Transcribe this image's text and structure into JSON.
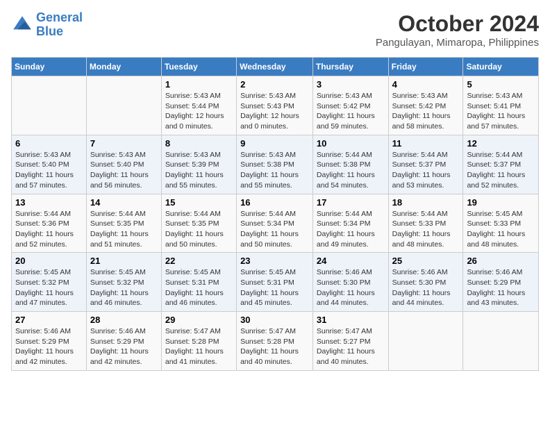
{
  "logo": {
    "line1": "General",
    "line2": "Blue"
  },
  "title": "October 2024",
  "subtitle": "Pangulayan, Mimaropa, Philippines",
  "days_of_week": [
    "Sunday",
    "Monday",
    "Tuesday",
    "Wednesday",
    "Thursday",
    "Friday",
    "Saturday"
  ],
  "weeks": [
    [
      {
        "day": "",
        "content": ""
      },
      {
        "day": "",
        "content": ""
      },
      {
        "day": "1",
        "content": "Sunrise: 5:43 AM\nSunset: 5:44 PM\nDaylight: 12 hours and 0 minutes."
      },
      {
        "day": "2",
        "content": "Sunrise: 5:43 AM\nSunset: 5:43 PM\nDaylight: 12 hours and 0 minutes."
      },
      {
        "day": "3",
        "content": "Sunrise: 5:43 AM\nSunset: 5:42 PM\nDaylight: 11 hours and 59 minutes."
      },
      {
        "day": "4",
        "content": "Sunrise: 5:43 AM\nSunset: 5:42 PM\nDaylight: 11 hours and 58 minutes."
      },
      {
        "day": "5",
        "content": "Sunrise: 5:43 AM\nSunset: 5:41 PM\nDaylight: 11 hours and 57 minutes."
      }
    ],
    [
      {
        "day": "6",
        "content": "Sunrise: 5:43 AM\nSunset: 5:40 PM\nDaylight: 11 hours and 57 minutes."
      },
      {
        "day": "7",
        "content": "Sunrise: 5:43 AM\nSunset: 5:40 PM\nDaylight: 11 hours and 56 minutes."
      },
      {
        "day": "8",
        "content": "Sunrise: 5:43 AM\nSunset: 5:39 PM\nDaylight: 11 hours and 55 minutes."
      },
      {
        "day": "9",
        "content": "Sunrise: 5:43 AM\nSunset: 5:38 PM\nDaylight: 11 hours and 55 minutes."
      },
      {
        "day": "10",
        "content": "Sunrise: 5:44 AM\nSunset: 5:38 PM\nDaylight: 11 hours and 54 minutes."
      },
      {
        "day": "11",
        "content": "Sunrise: 5:44 AM\nSunset: 5:37 PM\nDaylight: 11 hours and 53 minutes."
      },
      {
        "day": "12",
        "content": "Sunrise: 5:44 AM\nSunset: 5:37 PM\nDaylight: 11 hours and 52 minutes."
      }
    ],
    [
      {
        "day": "13",
        "content": "Sunrise: 5:44 AM\nSunset: 5:36 PM\nDaylight: 11 hours and 52 minutes."
      },
      {
        "day": "14",
        "content": "Sunrise: 5:44 AM\nSunset: 5:35 PM\nDaylight: 11 hours and 51 minutes."
      },
      {
        "day": "15",
        "content": "Sunrise: 5:44 AM\nSunset: 5:35 PM\nDaylight: 11 hours and 50 minutes."
      },
      {
        "day": "16",
        "content": "Sunrise: 5:44 AM\nSunset: 5:34 PM\nDaylight: 11 hours and 50 minutes."
      },
      {
        "day": "17",
        "content": "Sunrise: 5:44 AM\nSunset: 5:34 PM\nDaylight: 11 hours and 49 minutes."
      },
      {
        "day": "18",
        "content": "Sunrise: 5:44 AM\nSunset: 5:33 PM\nDaylight: 11 hours and 48 minutes."
      },
      {
        "day": "19",
        "content": "Sunrise: 5:45 AM\nSunset: 5:33 PM\nDaylight: 11 hours and 48 minutes."
      }
    ],
    [
      {
        "day": "20",
        "content": "Sunrise: 5:45 AM\nSunset: 5:32 PM\nDaylight: 11 hours and 47 minutes."
      },
      {
        "day": "21",
        "content": "Sunrise: 5:45 AM\nSunset: 5:32 PM\nDaylight: 11 hours and 46 minutes."
      },
      {
        "day": "22",
        "content": "Sunrise: 5:45 AM\nSunset: 5:31 PM\nDaylight: 11 hours and 46 minutes."
      },
      {
        "day": "23",
        "content": "Sunrise: 5:45 AM\nSunset: 5:31 PM\nDaylight: 11 hours and 45 minutes."
      },
      {
        "day": "24",
        "content": "Sunrise: 5:46 AM\nSunset: 5:30 PM\nDaylight: 11 hours and 44 minutes."
      },
      {
        "day": "25",
        "content": "Sunrise: 5:46 AM\nSunset: 5:30 PM\nDaylight: 11 hours and 44 minutes."
      },
      {
        "day": "26",
        "content": "Sunrise: 5:46 AM\nSunset: 5:29 PM\nDaylight: 11 hours and 43 minutes."
      }
    ],
    [
      {
        "day": "27",
        "content": "Sunrise: 5:46 AM\nSunset: 5:29 PM\nDaylight: 11 hours and 42 minutes."
      },
      {
        "day": "28",
        "content": "Sunrise: 5:46 AM\nSunset: 5:29 PM\nDaylight: 11 hours and 42 minutes."
      },
      {
        "day": "29",
        "content": "Sunrise: 5:47 AM\nSunset: 5:28 PM\nDaylight: 11 hours and 41 minutes."
      },
      {
        "day": "30",
        "content": "Sunrise: 5:47 AM\nSunset: 5:28 PM\nDaylight: 11 hours and 40 minutes."
      },
      {
        "day": "31",
        "content": "Sunrise: 5:47 AM\nSunset: 5:27 PM\nDaylight: 11 hours and 40 minutes."
      },
      {
        "day": "",
        "content": ""
      },
      {
        "day": "",
        "content": ""
      }
    ]
  ]
}
